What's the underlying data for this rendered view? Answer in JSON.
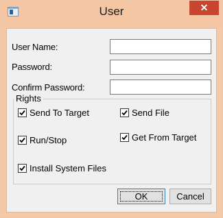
{
  "window": {
    "title": "User",
    "close_glyph": "✕"
  },
  "form": {
    "user_name_label": "User Name:",
    "password_label": "Password:",
    "confirm_password_label": "Confirm Password:",
    "user_name_value": "",
    "password_value": "",
    "confirm_password_value": ""
  },
  "rights": {
    "label": "Rights",
    "items": [
      {
        "label": "Send To Target",
        "checked": true
      },
      {
        "label": "Send File",
        "checked": true
      },
      {
        "label": "Run/Stop",
        "checked": true
      },
      {
        "label": "Get From Target",
        "checked": true
      },
      {
        "label": "Install System Files",
        "checked": true
      }
    ]
  },
  "buttons": {
    "ok_label": "OK",
    "cancel_label": "Cancel"
  },
  "colors": {
    "titlebar": "#f5c6a3",
    "close_button": "#c9452f",
    "client_bg": "#f0f0f0"
  },
  "icons": {
    "app": "app-window-icon",
    "close": "close-icon",
    "check": "checkmark-icon"
  }
}
